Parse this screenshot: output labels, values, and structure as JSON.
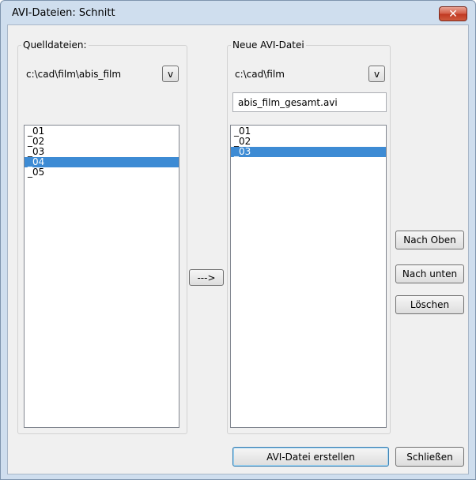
{
  "window": {
    "title": "AVI-Dateien: Schnitt",
    "close_label": "✕"
  },
  "source": {
    "legend": "Quelldateien:",
    "path": "c:\\cad\\film\\abis_film",
    "browse_label": "v",
    "items": [
      {
        "label": "_01",
        "selected": false
      },
      {
        "label": "_02",
        "selected": false
      },
      {
        "label": "_03",
        "selected": false
      },
      {
        "label": "_04",
        "selected": true
      },
      {
        "label": "_05",
        "selected": false
      }
    ]
  },
  "transfer_label": "--->",
  "target": {
    "legend": "Neue AVI-Datei",
    "path": "c:\\cad\\film",
    "browse_label": "v",
    "filename": "abis_film_gesamt.avi",
    "items": [
      {
        "label": "_01",
        "selected": false
      },
      {
        "label": "_02",
        "selected": false
      },
      {
        "label": "_03",
        "selected": true
      }
    ]
  },
  "actions": {
    "move_up": "Nach Oben",
    "move_down": "Nach unten",
    "delete": "Löschen"
  },
  "footer": {
    "create": "AVI-Datei erstellen",
    "close": "Schließen"
  },
  "colors": {
    "selection": "#3d8bd4",
    "frame": "#cfdeee"
  }
}
